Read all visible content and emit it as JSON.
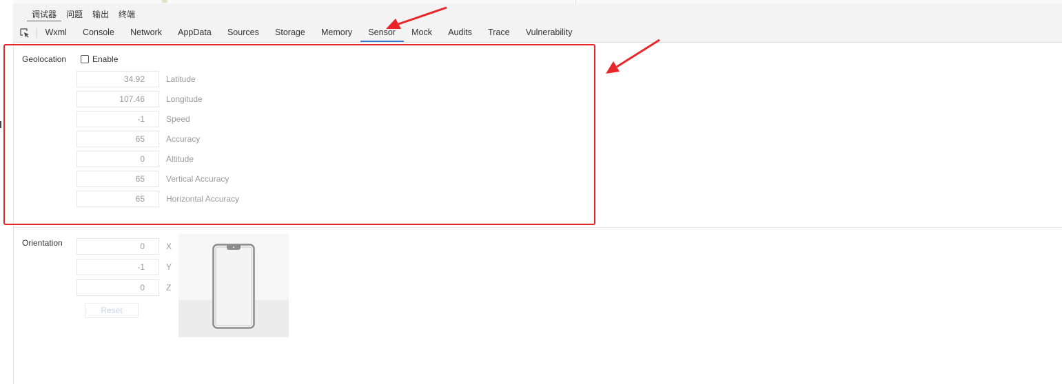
{
  "subtabs": [
    {
      "label": "调试器",
      "active": true
    },
    {
      "label": "问题",
      "active": false
    },
    {
      "label": "输出",
      "active": false
    },
    {
      "label": "终端",
      "active": false
    }
  ],
  "tabs": [
    {
      "label": "Wxml",
      "active": false
    },
    {
      "label": "Console",
      "active": false
    },
    {
      "label": "Network",
      "active": false
    },
    {
      "label": "AppData",
      "active": false
    },
    {
      "label": "Sources",
      "active": false
    },
    {
      "label": "Storage",
      "active": false
    },
    {
      "label": "Memory",
      "active": false
    },
    {
      "label": "Sensor",
      "active": true
    },
    {
      "label": "Mock",
      "active": false
    },
    {
      "label": "Audits",
      "active": false
    },
    {
      "label": "Trace",
      "active": false
    },
    {
      "label": "Vulnerability",
      "active": false
    }
  ],
  "geolocation": {
    "label": "Geolocation",
    "enable_label": "Enable",
    "enabled": false,
    "fields": [
      {
        "value": "34.92",
        "label": "Latitude"
      },
      {
        "value": "107.46",
        "label": "Longitude"
      },
      {
        "value": "-1",
        "label": "Speed"
      },
      {
        "value": "65",
        "label": "Accuracy"
      },
      {
        "value": "0",
        "label": "Altitude"
      },
      {
        "value": "65",
        "label": "Vertical Accuracy"
      },
      {
        "value": "65",
        "label": "Horizontal Accuracy"
      }
    ]
  },
  "orientation": {
    "label": "Orientation",
    "fields": [
      {
        "value": "0",
        "label": "X"
      },
      {
        "value": "-1",
        "label": "Y"
      },
      {
        "value": "0",
        "label": "Z"
      }
    ],
    "reset_label": "Reset"
  },
  "colors": {
    "accent": "#3a7bd5",
    "annotation": "#e8262a"
  },
  "icons": {
    "inspect": "element-picker-icon",
    "phone": "phone-preview-icon"
  }
}
